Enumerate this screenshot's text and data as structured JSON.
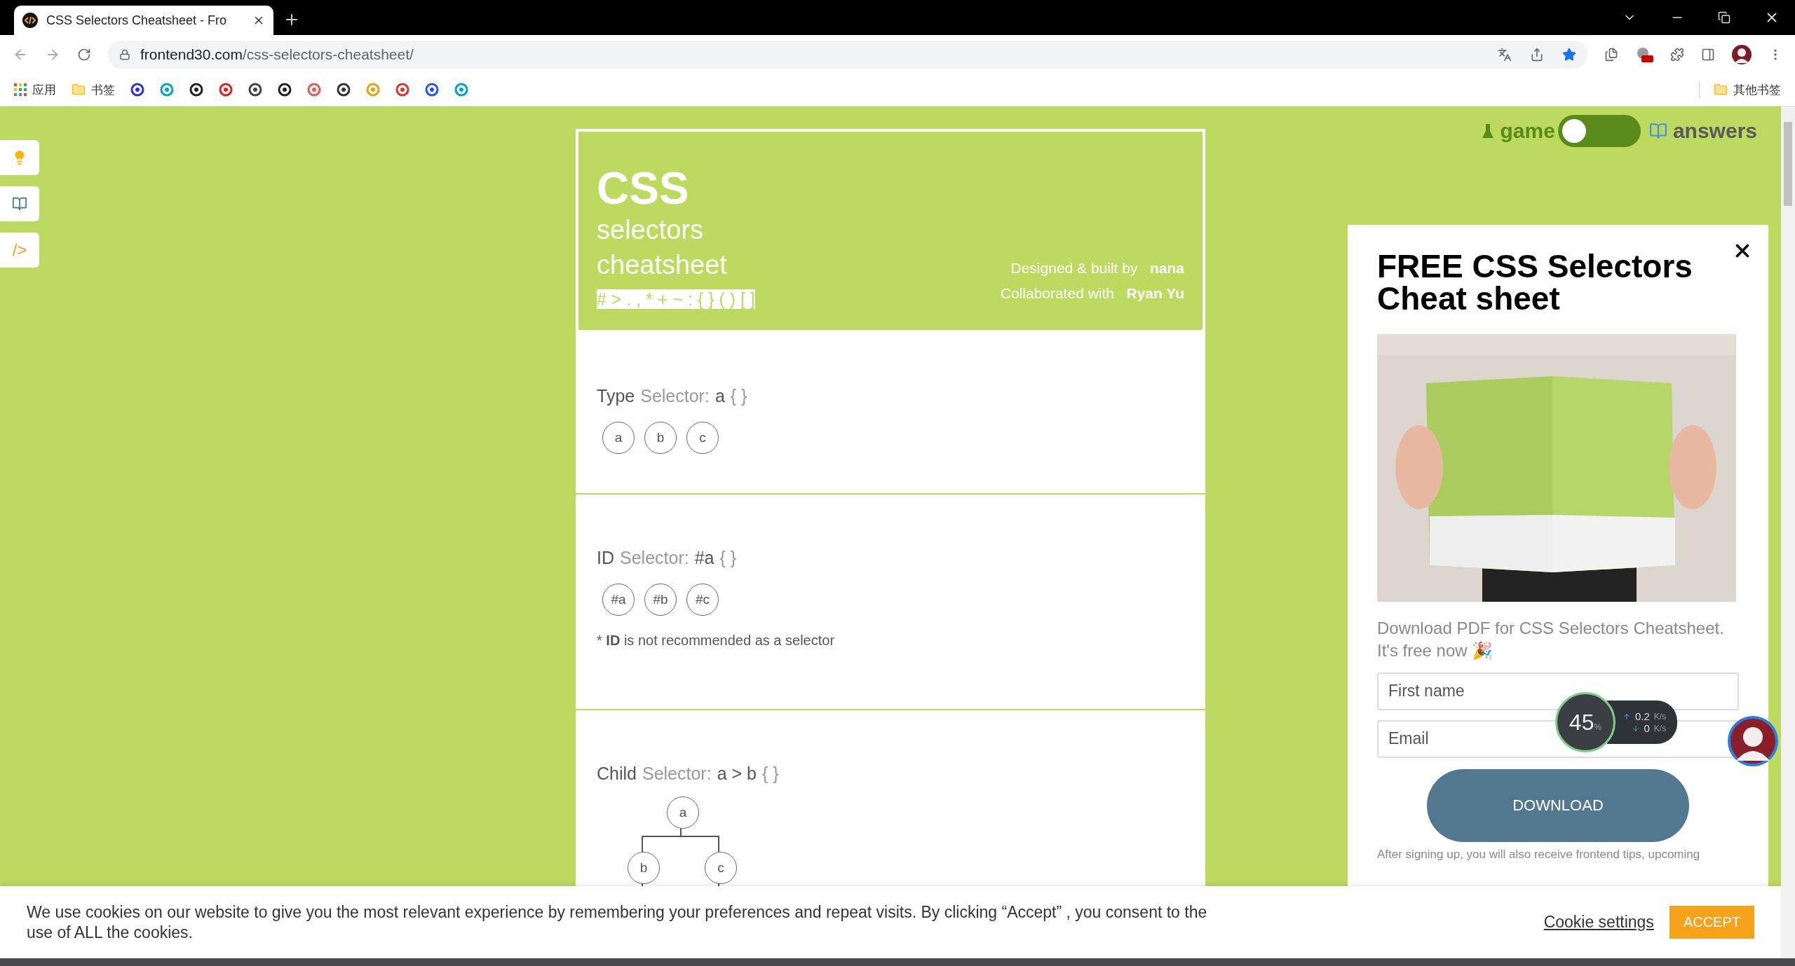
{
  "browser": {
    "tab_title": "CSS Selectors Cheatsheet - Fro",
    "url_domain": "frontend30.com",
    "url_path": "/css-selectors-cheatsheet/",
    "bookmarks": [
      {
        "label": "应用",
        "kind": "apps"
      },
      {
        "label": "书签",
        "kind": "folder"
      }
    ],
    "other_bookmarks": "其他书签"
  },
  "side_tools": [
    {
      "kind": "tip"
    },
    {
      "kind": "book"
    },
    {
      "kind": "code",
      "label": "/>"
    }
  ],
  "header": {
    "title": "CSS",
    "subtitle_1": "selectors",
    "subtitle_2": "cheatsheet",
    "symbols": "# > . , * + ~ : { } ( ) [ ]",
    "credits": [
      {
        "label": "Designed & built by",
        "name": "nana"
      },
      {
        "label": "Collaborated with",
        "name": "Ryan Yu"
      }
    ]
  },
  "sections": [
    {
      "kind": "row",
      "name": "Type",
      "label": "Selector:",
      "selector": "a",
      "braces": "{ }",
      "nodes": [
        "a",
        "b",
        "c"
      ]
    },
    {
      "kind": "row",
      "name": "ID",
      "label": "Selector:",
      "selector": "#a",
      "braces": "{ }",
      "nodes": [
        "#a",
        "#b",
        "#c"
      ],
      "note": "* **ID** is not recommended as a selector"
    },
    {
      "kind": "tree",
      "name": "Child",
      "label": "Selector:",
      "selector": "a > b",
      "braces": "{ }",
      "nodes": [
        "a",
        "b",
        "c"
      ]
    }
  ],
  "mode_toggle": {
    "left": "game",
    "right": "answers",
    "on": false
  },
  "popup": {
    "title": "FREE CSS Selectors Cheat sheet",
    "description": "Download PDF for CSS Selectors Cheatsheet. It's free now 🎉",
    "fields": [
      {
        "placeholder": "First name"
      },
      {
        "placeholder": "Email"
      }
    ],
    "button": "DOWNLOAD",
    "fine_print": "After signing up, you will also receive frontend tips, upcoming"
  },
  "speed_widget": {
    "percent": "45",
    "unit": "%",
    "up": "0.2",
    "up_unit": "K/s",
    "down": "0",
    "down_unit": "K/s"
  },
  "cookie": {
    "text": "We use cookies on our website to give you the most relevant experience by remembering your preferences and repeat visits. By clicking  “Accept” , you consent to the use of ALL the cookies.",
    "settings": "Cookie settings",
    "accept": "ACCEPT"
  }
}
